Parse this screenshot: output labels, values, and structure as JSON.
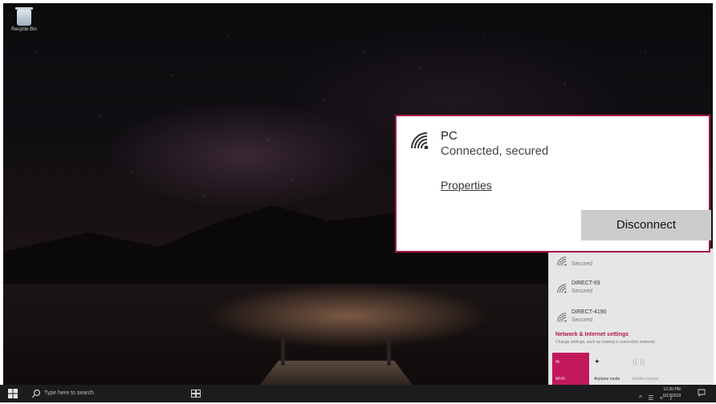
{
  "desktop": {
    "recycle_bin_label": "Recycle Bin"
  },
  "connection_panel": {
    "ssid": "PC",
    "status": "Connected, secured",
    "properties_link": "Properties",
    "disconnect_button": "Disconnect"
  },
  "network_list": {
    "items": [
      {
        "name": "",
        "status": "Secured"
      },
      {
        "name": "DIRECT-69",
        "status": "Secured"
      },
      {
        "name": "DIRECT-4190",
        "status": "Secured"
      }
    ],
    "settings_link": "Network & Internet settings",
    "settings_desc": "Change settings, such as making a connection metered.",
    "tiles": [
      {
        "label": "Wi-Fi"
      },
      {
        "label": "Airplane mode"
      },
      {
        "label": "Mobile hotspot"
      }
    ]
  },
  "taskbar": {
    "search_placeholder": "Type here to search",
    "clock_time": "12:20 PM",
    "clock_date": "6/13/2019"
  },
  "colors": {
    "accent": "#a51442",
    "wifi_tile": "#c2185b"
  }
}
